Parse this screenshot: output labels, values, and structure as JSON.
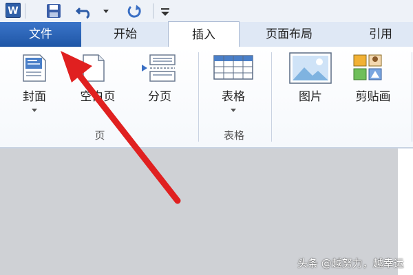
{
  "quick_access": {
    "app_icon_letter": "W",
    "icons": [
      "word-app-icon",
      "save-icon",
      "undo-icon",
      "undo-dropdown-icon",
      "redo-icon",
      "customize-dropdown-icon"
    ]
  },
  "tabs": [
    {
      "label": "文件"
    },
    {
      "label": "开始"
    },
    {
      "label": "插入"
    },
    {
      "label": "页面布局"
    },
    {
      "label": "引用"
    }
  ],
  "ribbon": {
    "groups": [
      {
        "label": "页",
        "buttons": [
          {
            "label": "封面",
            "icon": "cover-page-icon",
            "has_dropdown": true
          },
          {
            "label": "空白页",
            "icon": "blank-page-icon"
          },
          {
            "label": "分页",
            "icon": "page-break-icon"
          }
        ]
      },
      {
        "label": "表格",
        "buttons": [
          {
            "label": "表格",
            "icon": "table-icon",
            "has_dropdown": true
          }
        ]
      },
      {
        "label": "",
        "buttons": [
          {
            "label": "图片",
            "icon": "picture-icon"
          },
          {
            "label": "剪贴画",
            "icon": "clip-art-icon"
          }
        ]
      }
    ]
  },
  "annotation": {
    "arrow_color": "#e02020",
    "arrow_target": "文件"
  },
  "watermark": {
    "text": "头条 @越努力，越幸运"
  },
  "colors": {
    "file_tab": "#2a63b5",
    "tab_bar": "#dfe8f5",
    "document_area": "#cfd1d5"
  }
}
